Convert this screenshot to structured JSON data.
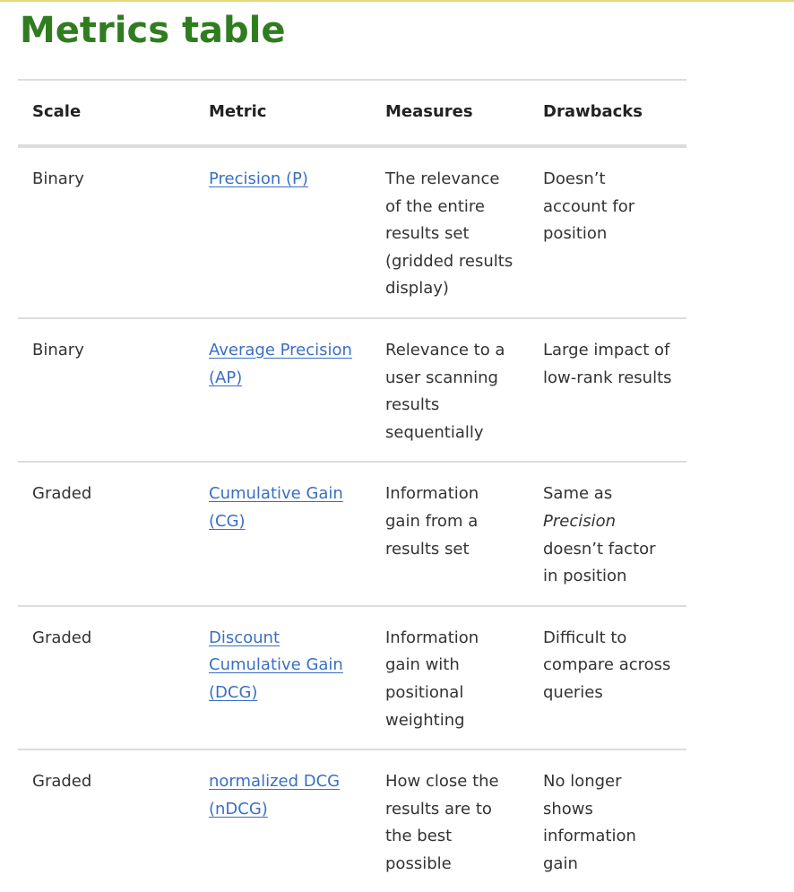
{
  "page": {
    "title": "Metrics table"
  },
  "table": {
    "headers": [
      "Scale",
      "Metric",
      "Measures",
      "Drawbacks"
    ],
    "rows": [
      {
        "scale": "Binary",
        "metric": "Precision (P)",
        "measures": "The relevance of the entire results set (gridded results display)",
        "drawbacks_em": "",
        "drawbacks": "Doesn’t account for position"
      },
      {
        "scale": "Binary",
        "metric": "Average Precision (AP)",
        "measures": "Relevance to a user scanning results sequentially",
        "drawbacks_em": "",
        "drawbacks": "Large impact of low-rank results"
      },
      {
        "scale": "Graded",
        "metric": "Cumulative Gain (CG)",
        "measures": "Information gain from a results set",
        "drawbacks_prefix": "Same as",
        "drawbacks_em": "Precision",
        "drawbacks": "doesn’t factor in position"
      },
      {
        "scale": "Graded",
        "metric": "Discount Cumulative Gain (DCG)",
        "measures": "Information gain with positional weighting",
        "drawbacks_em": "",
        "drawbacks": "Difficult to compare across queries"
      },
      {
        "scale": "Graded",
        "metric": "normalized DCG (nDCG)",
        "measures": "How close the results are to the best possible",
        "drawbacks_em": "",
        "drawbacks": "No longer shows information gain"
      }
    ]
  },
  "colors": {
    "title": "#2f7d1f",
    "link": "#3a6fc4",
    "rule": "#dcdcdc",
    "top_rule": "#e8d67a"
  }
}
